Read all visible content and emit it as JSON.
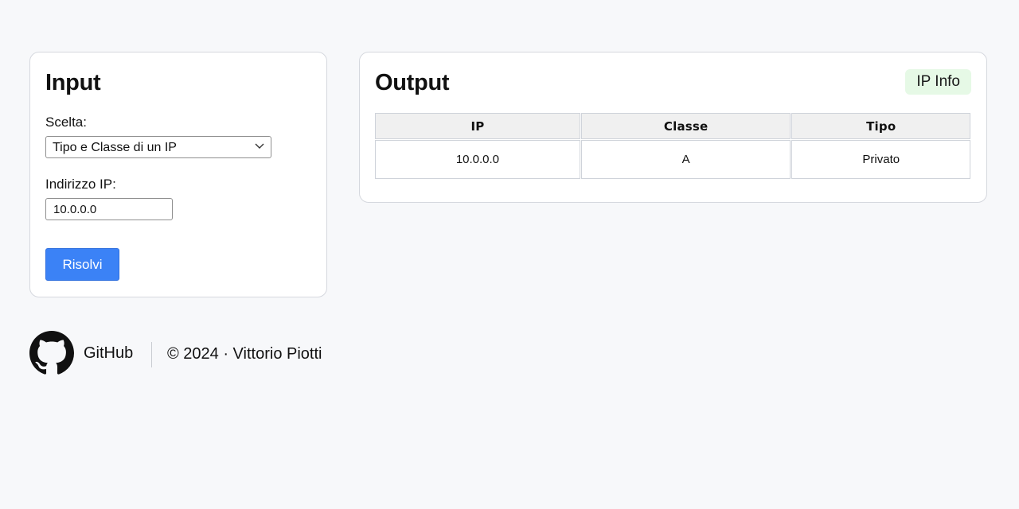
{
  "input_panel": {
    "title": "Input",
    "choice_label": "Scelta:",
    "choice_value": "Tipo e Classe di un IP",
    "ip_label": "Indirizzo IP:",
    "ip_value": "10.0.0.0",
    "submit_label": "Risolvi"
  },
  "output_panel": {
    "title": "Output",
    "badge": "IP Info",
    "table": {
      "headers": [
        "IP",
        "Classe",
        "Tipo"
      ],
      "rows": [
        [
          "10.0.0.0",
          "A",
          "Privato"
        ]
      ]
    }
  },
  "footer": {
    "github_label": "GitHub",
    "copyright": "© 2024 · Vittorio Piotti"
  },
  "colors": {
    "accent": "#3b82f6",
    "badge_bg": "#e6f9e6",
    "page_bg": "#f7f8fa"
  },
  "icons": {
    "select_chevron": "chevron-down-icon",
    "footer_logo": "github-icon"
  }
}
